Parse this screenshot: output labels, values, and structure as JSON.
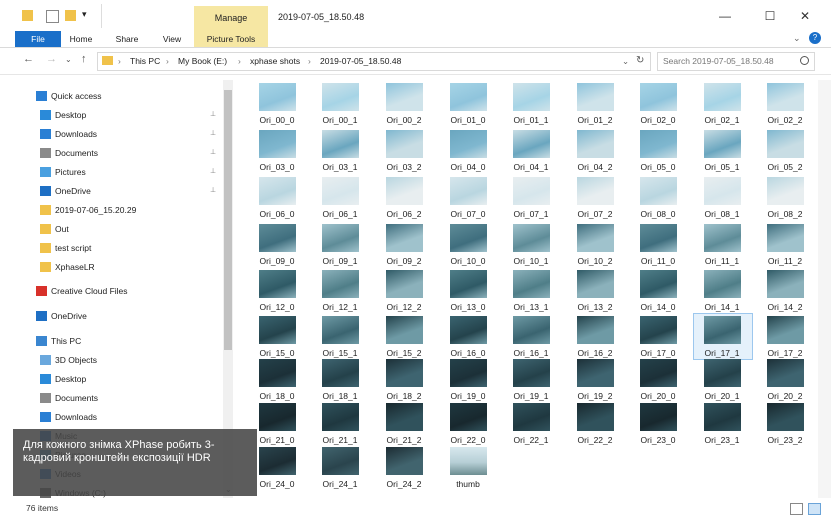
{
  "window": {
    "title": "2019-07-05_18.50.48",
    "context_tab": "Manage",
    "minimize_glyph": "—",
    "maximize_glyph": "☐",
    "close_glyph": "✕",
    "help_glyph": "?",
    "collapse_glyph": "⌄"
  },
  "ribbon": {
    "tabs": [
      "File",
      "Home",
      "Share",
      "View",
      "Picture Tools"
    ]
  },
  "address": {
    "back": "←",
    "forward": "→",
    "recent": "⌄",
    "up": "↑",
    "crumbs": [
      "This PC",
      "My Book (E:)",
      "xphase shots",
      "2019-07-05_18.50.48"
    ],
    "separator": "›",
    "refresh": "↻",
    "search_placeholder": "Search 2019-07-05_18.50.48"
  },
  "nav": {
    "items": [
      {
        "label": "Quick access",
        "icon": "star-icon",
        "pinned": false
      },
      {
        "label": "Desktop",
        "icon": "desktop-icon",
        "pinned": true
      },
      {
        "label": "Downloads",
        "icon": "downloads-icon",
        "pinned": true
      },
      {
        "label": "Documents",
        "icon": "documents-icon",
        "pinned": true
      },
      {
        "label": "Pictures",
        "icon": "pictures-icon",
        "pinned": true
      },
      {
        "label": "OneDrive",
        "icon": "onedrive-icon",
        "pinned": true
      },
      {
        "label": "2019-07-06_15.20.29",
        "icon": "folder-icon",
        "pinned": false
      },
      {
        "label": "Out",
        "icon": "folder-icon",
        "pinned": false
      },
      {
        "label": "test script",
        "icon": "folder-icon",
        "pinned": false
      },
      {
        "label": "XphaseLR",
        "icon": "folder-icon",
        "pinned": false
      },
      {
        "label": "Creative Cloud Files",
        "icon": "creative-cloud-icon",
        "pinned": false
      },
      {
        "label": "OneDrive",
        "icon": "onedrive-icon",
        "pinned": false
      },
      {
        "label": "This PC",
        "icon": "computer-icon",
        "pinned": false
      },
      {
        "label": "3D Objects",
        "icon": "3d-objects-icon",
        "pinned": false
      },
      {
        "label": "Desktop",
        "icon": "desktop-icon",
        "pinned": false
      },
      {
        "label": "Documents",
        "icon": "documents-icon",
        "pinned": false
      },
      {
        "label": "Downloads",
        "icon": "downloads-icon",
        "pinned": false
      },
      {
        "label": "Music",
        "icon": "music-icon",
        "pinned": false
      },
      {
        "label": "Pictures",
        "icon": "pictures-icon",
        "pinned": false
      },
      {
        "label": "Videos",
        "icon": "videos-icon",
        "pinned": false
      },
      {
        "label": "Windows (C:)",
        "icon": "drive-icon",
        "pinned": false
      }
    ],
    "pin_glyph": "📌",
    "collapse_glyph": "⌄"
  },
  "files": [
    "Ori_00_0",
    "Ori_00_1",
    "Ori_00_2",
    "Ori_01_0",
    "Ori_01_1",
    "Ori_01_2",
    "Ori_02_0",
    "Ori_02_1",
    "Ori_02_2",
    "Ori_03_0",
    "Ori_03_1",
    "Ori_03_2",
    "Ori_04_0",
    "Ori_04_1",
    "Ori_04_2",
    "Ori_05_0",
    "Ori_05_1",
    "Ori_05_2",
    "Ori_06_0",
    "Ori_06_1",
    "Ori_06_2",
    "Ori_07_0",
    "Ori_07_1",
    "Ori_07_2",
    "Ori_08_0",
    "Ori_08_1",
    "Ori_08_2",
    "Ori_09_0",
    "Ori_09_1",
    "Ori_09_2",
    "Ori_10_0",
    "Ori_10_1",
    "Ori_10_2",
    "Ori_11_0",
    "Ori_11_1",
    "Ori_11_2",
    "Ori_12_0",
    "Ori_12_1",
    "Ori_12_2",
    "Ori_13_0",
    "Ori_13_1",
    "Ori_13_2",
    "Ori_14_0",
    "Ori_14_1",
    "Ori_14_2",
    "Ori_15_0",
    "Ori_15_1",
    "Ori_15_2",
    "Ori_16_0",
    "Ori_16_1",
    "Ori_16_2",
    "Ori_17_0",
    "Ori_17_1",
    "Ori_17_2",
    "Ori_18_0",
    "Ori_18_1",
    "Ori_18_2",
    "Ori_19_0",
    "Ori_19_1",
    "Ori_19_2",
    "Ori_20_0",
    "Ori_20_1",
    "Ori_20_2",
    "Ori_21_0",
    "Ori_21_1",
    "Ori_21_2",
    "Ori_22_0",
    "Ori_22_1",
    "Ori_22_2",
    "Ori_23_0",
    "Ori_23_1",
    "Ori_23_2",
    "Ori_24_0",
    "Ori_24_1",
    "Ori_24_2",
    "thumb"
  ],
  "selected_file": "Ori_17_1",
  "caption": "Для кожного знімка XPhase робить 3-кадровий кронштейн експозиції HDR",
  "status": {
    "count": "76 items"
  },
  "colors": {
    "accent": "#1a6fc9",
    "context_tab": "#f6e7a3",
    "selection": "#e5f1fb"
  }
}
